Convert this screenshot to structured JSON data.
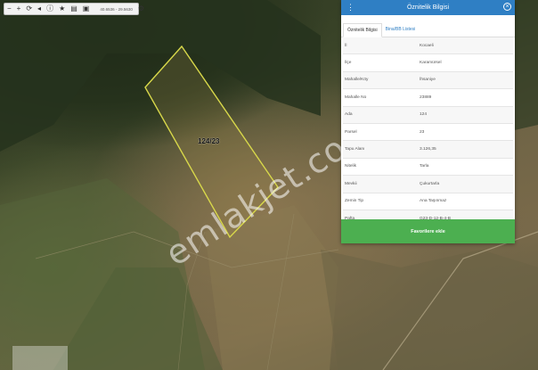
{
  "toolbar": {
    "coords": "40.6536 - 29.5630",
    "buttons": [
      "zoom-out",
      "zoom-in",
      "refresh",
      "back",
      "info",
      "favorite",
      "print",
      "save"
    ]
  },
  "map": {
    "parcel_label": "124/23",
    "watermark": "emlakjet.com"
  },
  "panel": {
    "title": "Öznitelik Bilgisi",
    "tabs": [
      {
        "label": "Öznitelik Bilgisi",
        "active": true
      },
      {
        "label": "Bina/BB Listesi",
        "active": false
      }
    ],
    "rows": [
      {
        "label": "İl",
        "value": "Kocaeli"
      },
      {
        "label": "İlçe",
        "value": "Karamürsel"
      },
      {
        "label": "Mahalle/Köy",
        "value": "İhsaniye"
      },
      {
        "label": "Mahalle No",
        "value": "23889"
      },
      {
        "label": "Ada",
        "value": "124"
      },
      {
        "label": "Parsel",
        "value": "23"
      },
      {
        "label": "Tapu Alanı",
        "value": "3.126,35"
      },
      {
        "label": "Nitelik",
        "value": "Tarla"
      },
      {
        "label": "Mevkii",
        "value": "Çukurtarla"
      },
      {
        "label": "Zemin Tip",
        "value": "Ana Taşınmaz"
      },
      {
        "label": "Pafta",
        "value": "G23-D-12-B-4-B"
      }
    ],
    "favorite_label": "Favorilere ekle"
  },
  "colors": {
    "header": "#2f7fc4",
    "favorite": "#4caf50",
    "parcel_outline": "#d8d84a"
  }
}
